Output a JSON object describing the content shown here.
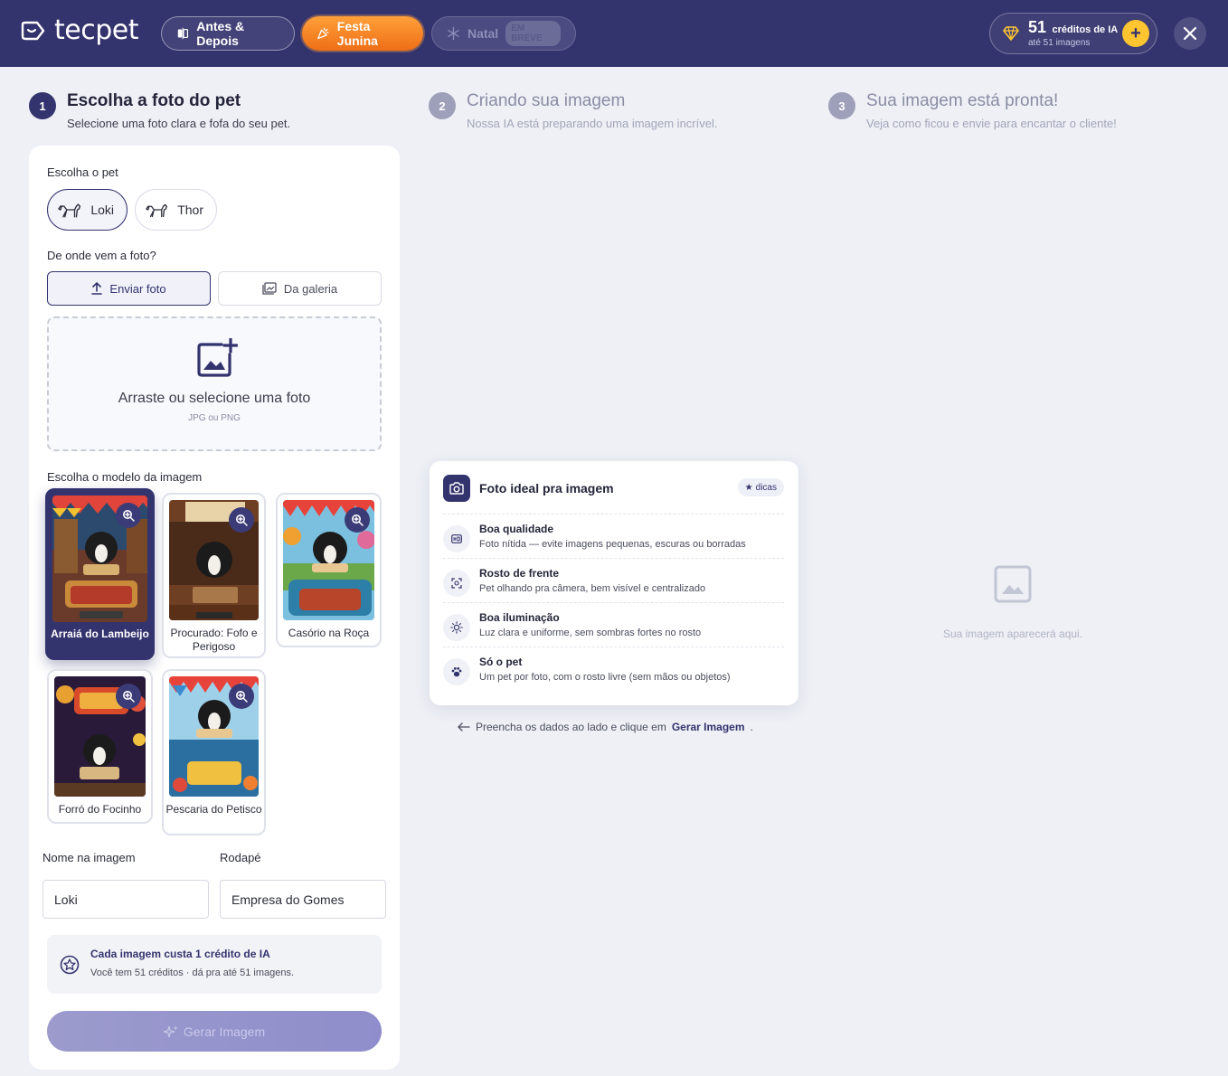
{
  "header": {
    "logo": "tecpet",
    "tabs": [
      {
        "label": "Antes & Depois",
        "icon": "before-after-icon"
      },
      {
        "label": "Festa Junina",
        "icon": "party-popper-icon"
      },
      {
        "label": "Natal",
        "icon": "snowflake-icon",
        "badge": "EM BREVE"
      }
    ],
    "credits": {
      "count": "51",
      "label": "créditos de IA",
      "sub": "até 51 imagens",
      "add": "+"
    }
  },
  "steps": [
    {
      "num": "1",
      "title": "Escolha a foto do pet",
      "desc": "Selecione uma foto clara e fofa do seu pet."
    },
    {
      "num": "2",
      "title": "Criando sua imagem",
      "desc": "Nossa IA está preparando uma imagem incrível."
    },
    {
      "num": "3",
      "title": "Sua imagem está pronta!",
      "desc": "Veja como ficou e envie para encantar o cliente!"
    }
  ],
  "form": {
    "pet_label": "Escolha o pet",
    "pets": [
      "Loki",
      "Thor"
    ],
    "source_label": "De onde vem a foto?",
    "source_upload": "Enviar foto",
    "source_gallery": "Da galeria",
    "drop_title": "Arraste ou selecione uma foto",
    "drop_sub": "JPG ou PNG",
    "template_label": "Escolha o modelo da imagem",
    "templates": [
      {
        "name": "Arraiá do Lambeijo"
      },
      {
        "name": "Procurado: Fofo e Perigoso"
      },
      {
        "name": "Casório na Roça"
      },
      {
        "name": "Forró do Focinho"
      },
      {
        "name": "Pescaria do Petisco"
      }
    ],
    "name_label": "Nome na imagem",
    "name_value": "Loki",
    "footer_label": "Rodapé",
    "footer_value": "Empresa do Gomes",
    "info_title": "Cada imagem custa 1 crédito de IA",
    "info_sub": "Você tem 51 créditos · dá pra até 51 imagens.",
    "generate": "Gerar Imagem"
  },
  "tips": {
    "title": "Foto ideal pra imagem",
    "badge": "dicas",
    "items": [
      {
        "title": "Boa qualidade",
        "desc": "Foto nítida — evite imagens pequenas, escuras ou borradas",
        "icon": "hd-icon"
      },
      {
        "title": "Rosto de frente",
        "desc": "Pet olhando pra câmera, bem visível e centralizado",
        "icon": "face-scan-icon"
      },
      {
        "title": "Boa iluminação",
        "desc": "Luz clara e uniforme, sem sombras fortes no rosto",
        "icon": "sun-icon"
      },
      {
        "title": "Só o pet",
        "desc": "Um pet por foto, com o rosto livre (sem mãos ou objetos)",
        "icon": "paw-icon"
      }
    ],
    "hint_text": "Preencha os dados ao lado e clique em",
    "hint_link": "Gerar Imagem",
    "hint_end": "."
  },
  "result": {
    "placeholder": "Sua imagem aparecerá aqui."
  },
  "colors": {
    "primary": "#33336e",
    "accent": "#ee6e16",
    "credit": "#ffc531"
  }
}
